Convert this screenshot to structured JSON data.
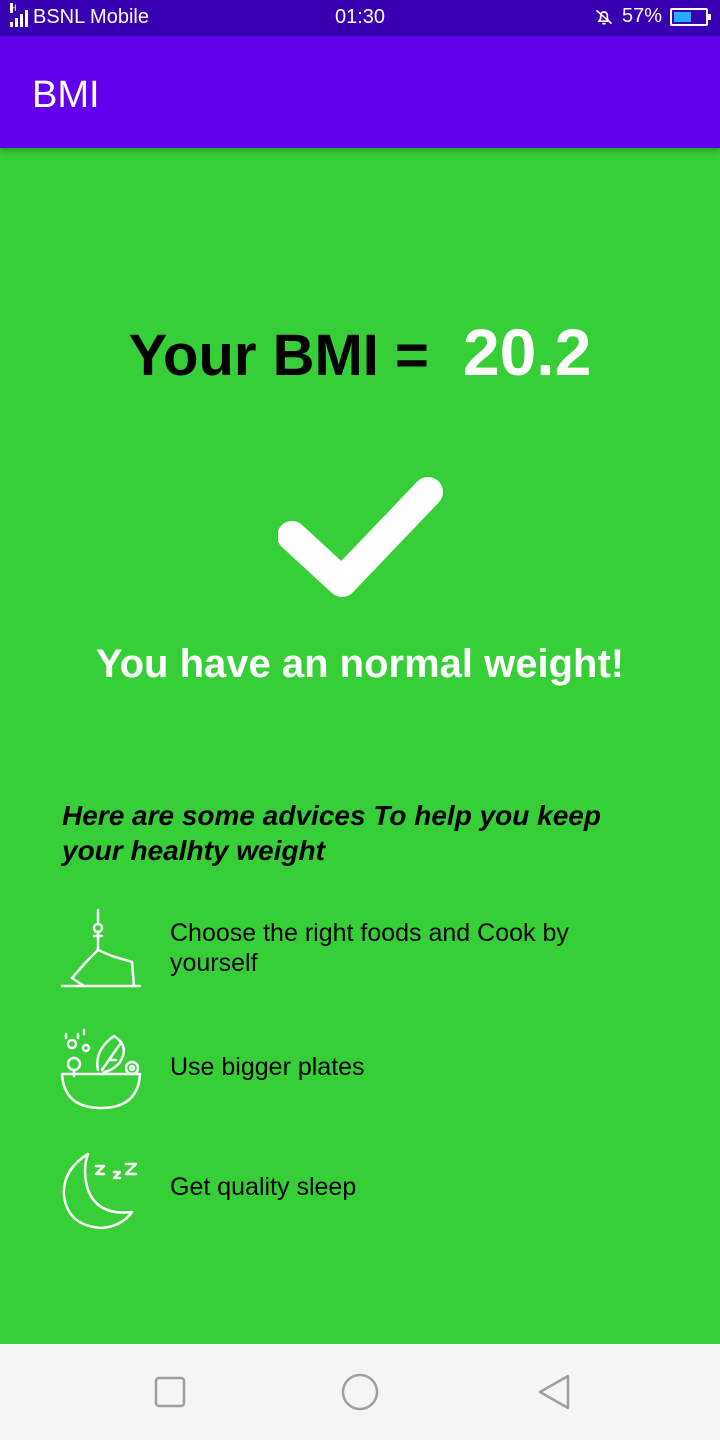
{
  "status_bar": {
    "carrier": "BSNL Mobile",
    "network_type": "H",
    "time": "01:30",
    "battery": "57%",
    "battery_level": 0.57,
    "icons": [
      "signal-icon",
      "bell-off-icon",
      "battery-icon"
    ]
  },
  "app_bar": {
    "title": "BMI"
  },
  "result": {
    "bmi_label": "Your BMI =",
    "bmi_value": "20.2",
    "status_icon": "checkmark-icon",
    "message": "You have an normal weight!"
  },
  "advice": {
    "heading": "Here are some advices To help you keep your healhty weight",
    "items": [
      {
        "icon": "yoga-pose-icon",
        "text": "Choose the right foods and Cook by yourself"
      },
      {
        "icon": "salad-bowl-icon",
        "text": "Use bigger plates"
      },
      {
        "icon": "moon-sleep-icon",
        "text": "Get quality sleep"
      }
    ]
  },
  "nav_bar": {
    "buttons": [
      "recent-apps-icon",
      "home-icon",
      "back-icon"
    ]
  },
  "colors": {
    "background": "#36cf37",
    "app_bar": "#6200ee",
    "status_bar": "#3700b3",
    "nav_bar": "#f5f5f5"
  }
}
